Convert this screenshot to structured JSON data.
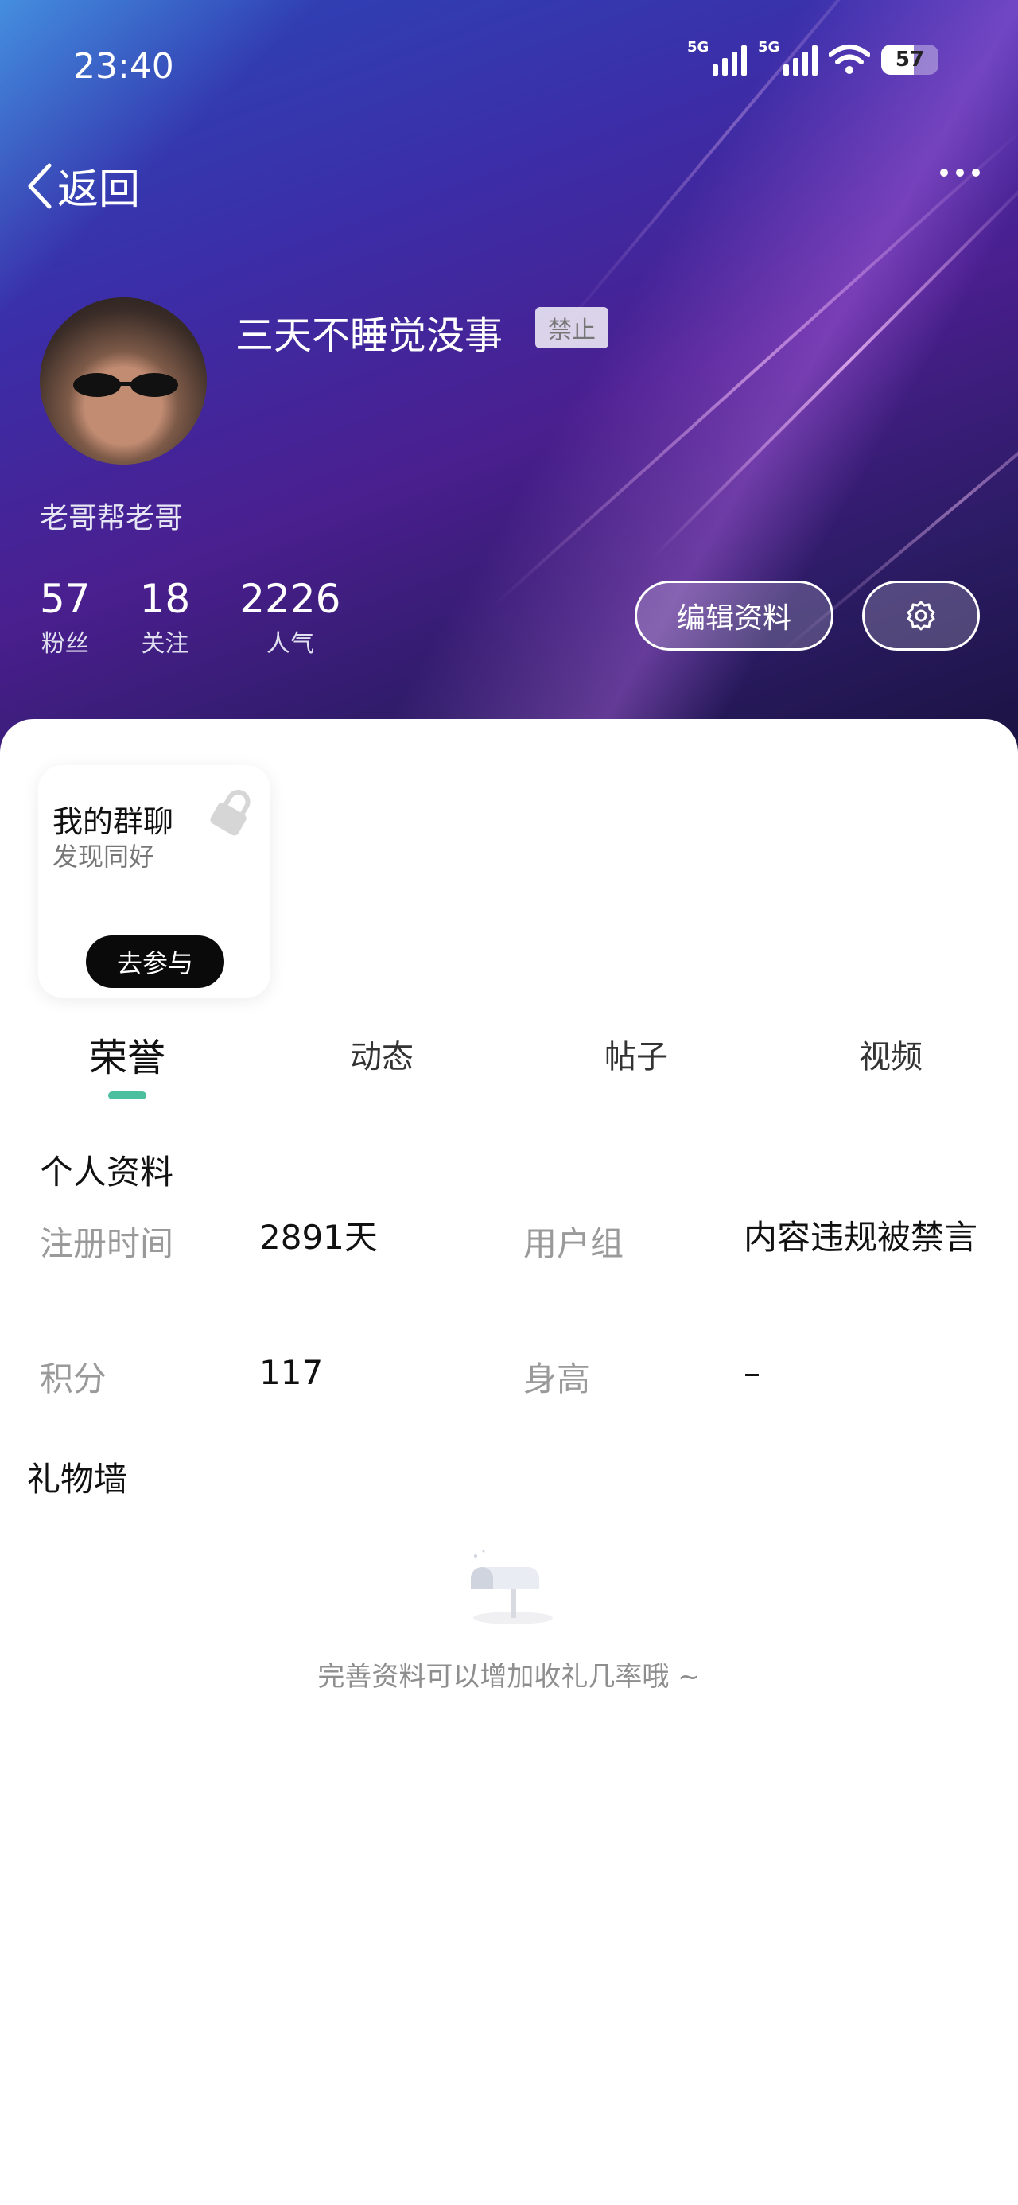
{
  "status_bar": {
    "time": "23:40",
    "network_1": "5G",
    "network_2": "5G",
    "battery": "57",
    "battery_level": 0.57
  },
  "nav": {
    "back_label": "返回"
  },
  "profile": {
    "name": "三天不睡觉没事",
    "ban_badge": "禁止",
    "bio": "老哥帮老哥",
    "stats": [
      {
        "value": "57",
        "label": "粉丝"
      },
      {
        "value": "18",
        "label": "关注"
      },
      {
        "value": "2226",
        "label": "人气"
      }
    ],
    "edit_button": "编辑资料"
  },
  "group_card": {
    "title": "我的群聊",
    "subtitle": "发现同好",
    "join_button": "去参与"
  },
  "tabs": [
    {
      "label": "荣誉",
      "active": true
    },
    {
      "label": "动态",
      "active": false
    },
    {
      "label": "帖子",
      "active": false
    },
    {
      "label": "视频",
      "active": false
    }
  ],
  "personal_info": {
    "title": "个人资料",
    "rows": [
      {
        "label": "注册时间",
        "value": "2891天"
      },
      {
        "label": "用户组",
        "value": "内容违规被禁言"
      },
      {
        "label": "积分",
        "value": "117"
      },
      {
        "label": "身高",
        "value": "–"
      }
    ]
  },
  "gift_wall": {
    "title": "礼物墙",
    "empty_text": "完善资料可以增加收礼几率哦 ~"
  },
  "colors": {
    "accent": "#4cbf9e"
  }
}
